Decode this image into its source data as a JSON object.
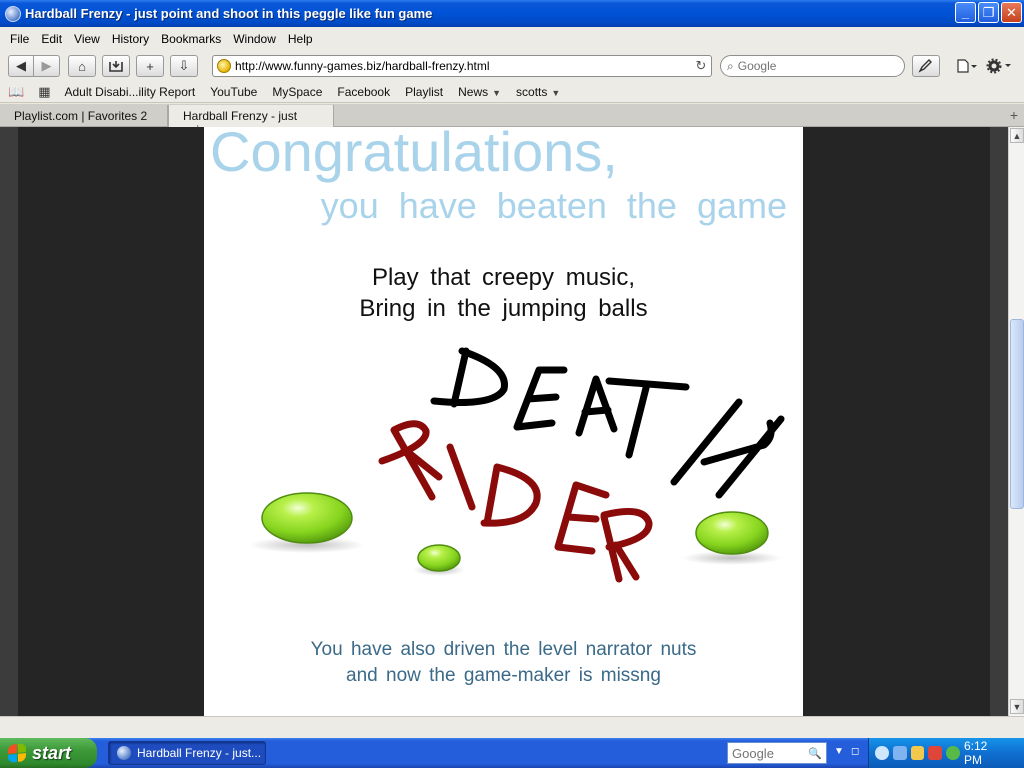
{
  "window": {
    "title": "Hardball Frenzy - just point and shoot in this peggle like fun game",
    "minimize": "_",
    "maximize": "❐",
    "close": "✕"
  },
  "menu": [
    "File",
    "Edit",
    "View",
    "History",
    "Bookmarks",
    "Window",
    "Help"
  ],
  "toolbar": {
    "back": "◀",
    "forward": "▶",
    "home": "⌂",
    "add_bookmark": "+",
    "download": "⇩",
    "url": "http://www.funny-games.biz/hardball-frenzy.html",
    "reload": "↻",
    "search_placeholder": "Google"
  },
  "bookmarks": [
    {
      "label": "Adult Disabi...ility Report",
      "menu": false
    },
    {
      "label": "YouTube",
      "menu": false
    },
    {
      "label": "MySpace",
      "menu": false
    },
    {
      "label": "Facebook",
      "menu": false
    },
    {
      "label": "Playlist",
      "menu": false
    },
    {
      "label": "News",
      "menu": true
    },
    {
      "label": "scotts",
      "menu": true
    }
  ],
  "tabs": [
    {
      "label": "Playlist.com | Favorites 2",
      "active": false
    },
    {
      "label": "Hardball Frenzy - just poi...",
      "active": true
    }
  ],
  "game": {
    "heading": "Congratulations,",
    "subheading": "you have beaten the game",
    "line1": "Play that creepy music,",
    "line2": "Bring in the jumping balls",
    "scrawl_top": "DEATH",
    "scrawl_bottom": "RIDER",
    "footer1": "You have also driven the level narrator nuts",
    "footer2": "and now the game-maker is missng",
    "colors": {
      "heading": "#a8d3ea",
      "footer": "#3a6a88",
      "scrawl_top": "#000000",
      "scrawl_bottom": "#8b0a0a",
      "ball": "#8fdc2e"
    }
  },
  "taskbar": {
    "start_label": "start",
    "task_label": "Hardball Frenzy - just...",
    "search_placeholder": "Google",
    "clock": "6:12 PM"
  }
}
